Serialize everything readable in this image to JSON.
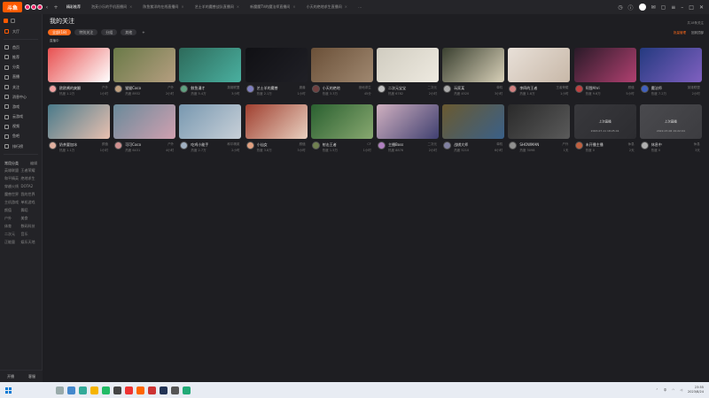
{
  "topbar": {
    "logo": "斗鱼",
    "tabs": [
      "精彩推荐",
      "泡芙小乐的手机直播间",
      "陈鱼紫洋的在线直播间",
      "艺士羊的魔兽战队直播间",
      "新魔魔TV的魔法师直播间",
      "小天的绝地求生直播间"
    ],
    "tab_close": "×"
  },
  "sidebar": {
    "top_label": "大厅",
    "items": [
      "首页",
      "推荐",
      "分类",
      "直播",
      "关注",
      "消息中心",
      "游戏",
      "云游戏",
      "视频",
      "鱼吧",
      "排行榜"
    ],
    "section_title": "常用分类",
    "section_action": "编辑",
    "categories": [
      "英雄联盟",
      "王者荣耀",
      "和平精英",
      "绝地求生",
      "穿越火线",
      "DOTA2",
      "魔兽世界",
      "我的世界",
      "主机游戏",
      "单机游戏",
      "颜值",
      "舞蹈",
      "户外",
      "美食",
      "体育",
      "数码科技",
      "二次元",
      "音乐",
      "正能量",
      "娱乐天地"
    ],
    "bottom_left": "开播",
    "bottom_right": "客服"
  },
  "main": {
    "title": "我的关注",
    "meta": "共18条关注",
    "filters": [
      "全部(18)",
      "特别关注",
      "分组",
      "其他",
      "+"
    ],
    "actions_orange": "批量管理",
    "actions_grey": "回到顶部",
    "sub_note": "直播中",
    "card_stat_prefix": "热度"
  },
  "cards": [
    {
      "name": "欧欧酱的爽翻",
      "cat": "户外",
      "stat": "1.2万",
      "time": "1小时",
      "c1": "#e85050",
      "c2": "#ffffff",
      "av": "#f0a0a0"
    },
    {
      "name": "猫猫Coco",
      "cat": "户外",
      "stat": "8932",
      "time": "2小时",
      "c1": "#6a7a48",
      "c2": "#b59e80",
      "av": "#c0a080"
    },
    {
      "name": "鲸鱼漫才",
      "cat": "英雄联盟",
      "stat": "5.4万",
      "time": "3小时",
      "c1": "#2d6a5a",
      "c2": "#4ab0a0",
      "av": "#60a080"
    },
    {
      "name": "艺士羊的魔兽",
      "cat": "魔兽",
      "stat": "2.1万",
      "time": "1小时",
      "c1": "#101014",
      "c2": "#202026",
      "av": "#8080c0"
    },
    {
      "name": "小天的绝地",
      "cat": "绝地求生",
      "stat": "3.3万",
      "time": "45分",
      "c1": "#6a5038",
      "c2": "#a08870",
      "av": "#704040"
    },
    {
      "name": "二次元宝宝",
      "cat": "二次元",
      "stat": "6782",
      "time": "2小时",
      "c1": "#d0ccc0",
      "c2": "#eeeae0",
      "av": "#c0c0c0"
    },
    {
      "name": "玩家某",
      "cat": "单机",
      "stat": "4520",
      "time": "3小时",
      "c1": "#3a4030",
      "c2": "#d8d0b8",
      "av": "#aaaaaa"
    },
    {
      "name": "李四的王者",
      "cat": "王者荣耀",
      "stat": "1.8万",
      "time": "1小时",
      "c1": "#e8e0d8",
      "c2": "#c8b8a8",
      "av": "#d08080"
    },
    {
      "name": "阿狸Ahri",
      "cat": "颜值",
      "stat": "9.6万",
      "time": "5小时",
      "c1": "#2a1a28",
      "c2": "#b04070",
      "av": "#c04040"
    },
    {
      "name": "魔法师",
      "cat": "英雄联盟",
      "stat": "7.2万",
      "time": "2小时",
      "c1": "#243a80",
      "c2": "#8060c0",
      "av": "#4060c0"
    },
    {
      "name": "奶茶要加冰",
      "cat": "颜值",
      "stat": "1.1万",
      "time": "1小时",
      "c1": "#4a7a8a",
      "c2": "#e8c0b0",
      "av": "#e0b0a0"
    },
    {
      "name": "可可Coco",
      "cat": "户外",
      "stat": "6431",
      "time": "4小时",
      "c1": "#6a8a9a",
      "c2": "#d0a0b0",
      "av": "#d09090"
    },
    {
      "name": "吃鸡小能手",
      "cat": "和平精英",
      "stat": "2.7万",
      "time": "2小时",
      "c1": "#7898b0",
      "c2": "#c8d0d8",
      "av": "#a0b0c0"
    },
    {
      "name": "小仙女",
      "cat": "颜值",
      "stat": "3.8万",
      "time": "3小时",
      "c1": "#a04030",
      "c2": "#e8d0c0",
      "av": "#e0a080"
    },
    {
      "name": "射击王者",
      "cat": "CF",
      "stat": "1.5万",
      "time": "1小时",
      "c1": "#2a6030",
      "c2": "#88a870",
      "av": "#708050"
    },
    {
      "name": "主播Boss",
      "cat": "二次元",
      "stat": "8876",
      "time": "2小时",
      "c1": "#d0b0c0",
      "c2": "#404070",
      "av": "#b080c0"
    },
    {
      "name": "战棋大师",
      "cat": "单机",
      "stat": "5210",
      "time": "6小时",
      "c1": "#6a5a30",
      "c2": "#3a6088",
      "av": "#8080a0"
    },
    {
      "name": "SHOWMAN",
      "cat": "户外",
      "stat": "3098",
      "time": "1天",
      "c1": "#2a2a2a",
      "c2": "#5a5a5a",
      "av": "#909090"
    },
    {
      "name": "未开播主播",
      "cat": "休息",
      "stat": "0",
      "time": "2天",
      "c1": "#38383c",
      "c2": "#2c2c30",
      "av": "#c06040",
      "offline": true,
      "label": "上次直播",
      "date": "2023-07-11 18:25:41"
    },
    {
      "name": "休息中",
      "cat": "休息",
      "stat": "0",
      "time": "3天",
      "c1": "#4a4a4e",
      "c2": "#3c3c40",
      "av": "#b0b0b0",
      "offline": true,
      "label": "上次直播",
      "date": "2022-07-06 19:22:04"
    }
  ],
  "taskbar": {
    "time": "23:55",
    "date": "2023/8/24",
    "tray_text": "中"
  },
  "colors": {
    "accent": "#ff6a1a",
    "bg": "#1e1e22"
  }
}
